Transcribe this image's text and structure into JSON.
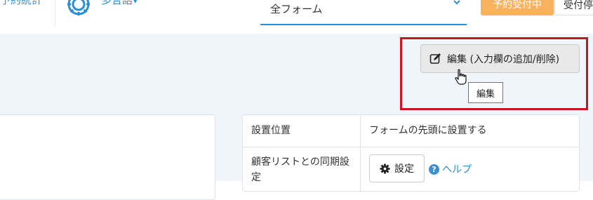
{
  "header": {
    "nav_left_label": "予約統計",
    "nav_multilang_label": "多言語▾",
    "form_select_value": "全フォーム",
    "orange_button_label": "予約受付中",
    "white_button_label": "受付停"
  },
  "toolbar": {
    "edit_button_label": "編集 (入力欄の追加/削除)",
    "tooltip_text": "編集"
  },
  "settings_table": {
    "rows": [
      {
        "label": "設置位置",
        "value": "フォームの先頭に設置する"
      },
      {
        "label": "顧客リストとの同期設定",
        "button_label": "設定",
        "help_label": "ヘルプ"
      }
    ]
  },
  "colors": {
    "accent": "#2a8fd6",
    "highlight": "#d0121b",
    "orange": "#f7b15f",
    "panel_bg": "#f0f5fb"
  }
}
